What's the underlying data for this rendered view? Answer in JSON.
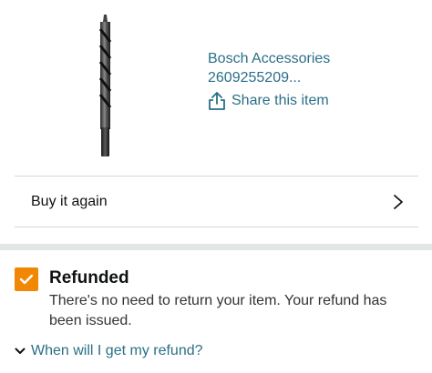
{
  "product": {
    "title": "Bosch Accessories 2609255209...",
    "share_label": "Share this item",
    "image": "drill-bit"
  },
  "buy_again": {
    "label": "Buy it again",
    "icon": "chevron-right-icon"
  },
  "status": {
    "title": "Refunded",
    "message": "There's no need to return your item. Your refund has been issued.",
    "checkbox_color": "#f08804"
  },
  "refund_link": {
    "label": "When will I get my refund?",
    "icon": "chevron-down-icon"
  },
  "colors": {
    "link": "#2a6f87",
    "accent": "#f08804",
    "divider": "#d5d9d9"
  }
}
